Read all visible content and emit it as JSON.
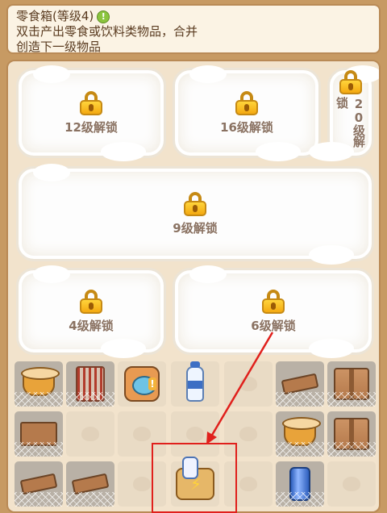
{
  "info": {
    "title": "零食箱(等级4)",
    "hint_icon": "!",
    "description_line1": "双击产出零食或饮料类物品，合并",
    "description_line2": "创造下一级物品"
  },
  "locked_areas": [
    {
      "id": "a1",
      "label": "12级解锁"
    },
    {
      "id": "a2",
      "label": "16级解锁"
    },
    {
      "id": "a3",
      "label": "20级解锁"
    },
    {
      "id": "a4",
      "label": "9级解锁"
    },
    {
      "id": "a5",
      "label": "4级解锁"
    },
    {
      "id": "a6",
      "label": "6级解锁"
    }
  ],
  "grid_items": {
    "row1": [
      "noodle-cup",
      "chips-bag",
      "toast-box",
      "milk-bottle",
      "empty",
      "crate-webbed",
      "box-webbed"
    ],
    "row2": [
      "crate-webbed",
      "empty",
      "empty",
      "empty",
      "empty",
      "noodle-cup-webbed",
      "box-webbed"
    ],
    "row3": [
      "plank-webbed",
      "plank-webbed",
      "empty",
      "snack-box-selected",
      "empty",
      "soda-can-webbed",
      "empty"
    ]
  },
  "colors": {
    "highlight": "#e0201c",
    "board_bg": "#f2e3cc",
    "lock_gold": "#f4a911"
  }
}
